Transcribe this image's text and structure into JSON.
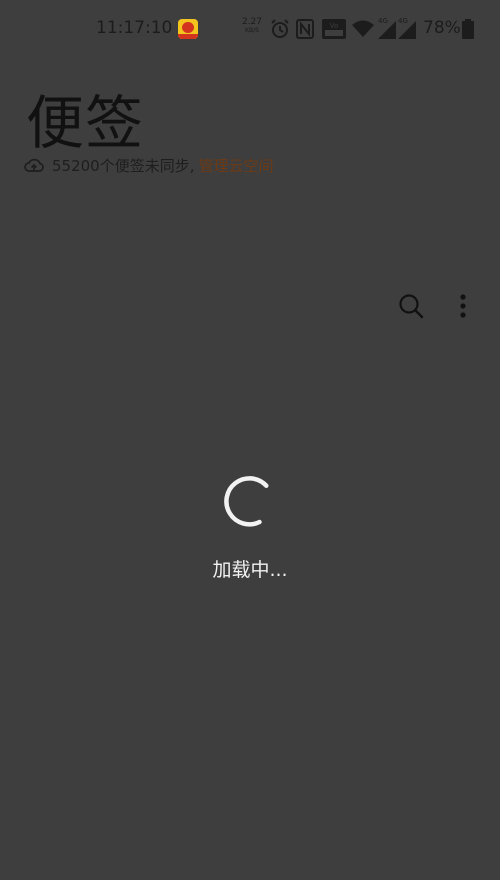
{
  "status_bar": {
    "time": "11:17:10",
    "net_speed_value": "2.27",
    "net_speed_unit": "KB/S",
    "network_label_1": "4G",
    "network_label_2": "4G",
    "battery_percent": "78%",
    "icons": [
      "app-notification-icon",
      "alarm-icon",
      "nfc-icon",
      "volte-icon",
      "wifi-icon",
      "signal-icon",
      "signal-icon",
      "battery-icon"
    ]
  },
  "header": {
    "title": "便签",
    "sync_status": "55200个便签未同步,",
    "manage_link": "管理云空间"
  },
  "toolbar": {
    "icons": [
      "search-icon",
      "more-options-icon"
    ]
  },
  "loading": {
    "text": "加载中..."
  },
  "colors": {
    "background": "#3e3e3e",
    "link": "#6b3a16",
    "loading_text": "#f2f2f2"
  }
}
